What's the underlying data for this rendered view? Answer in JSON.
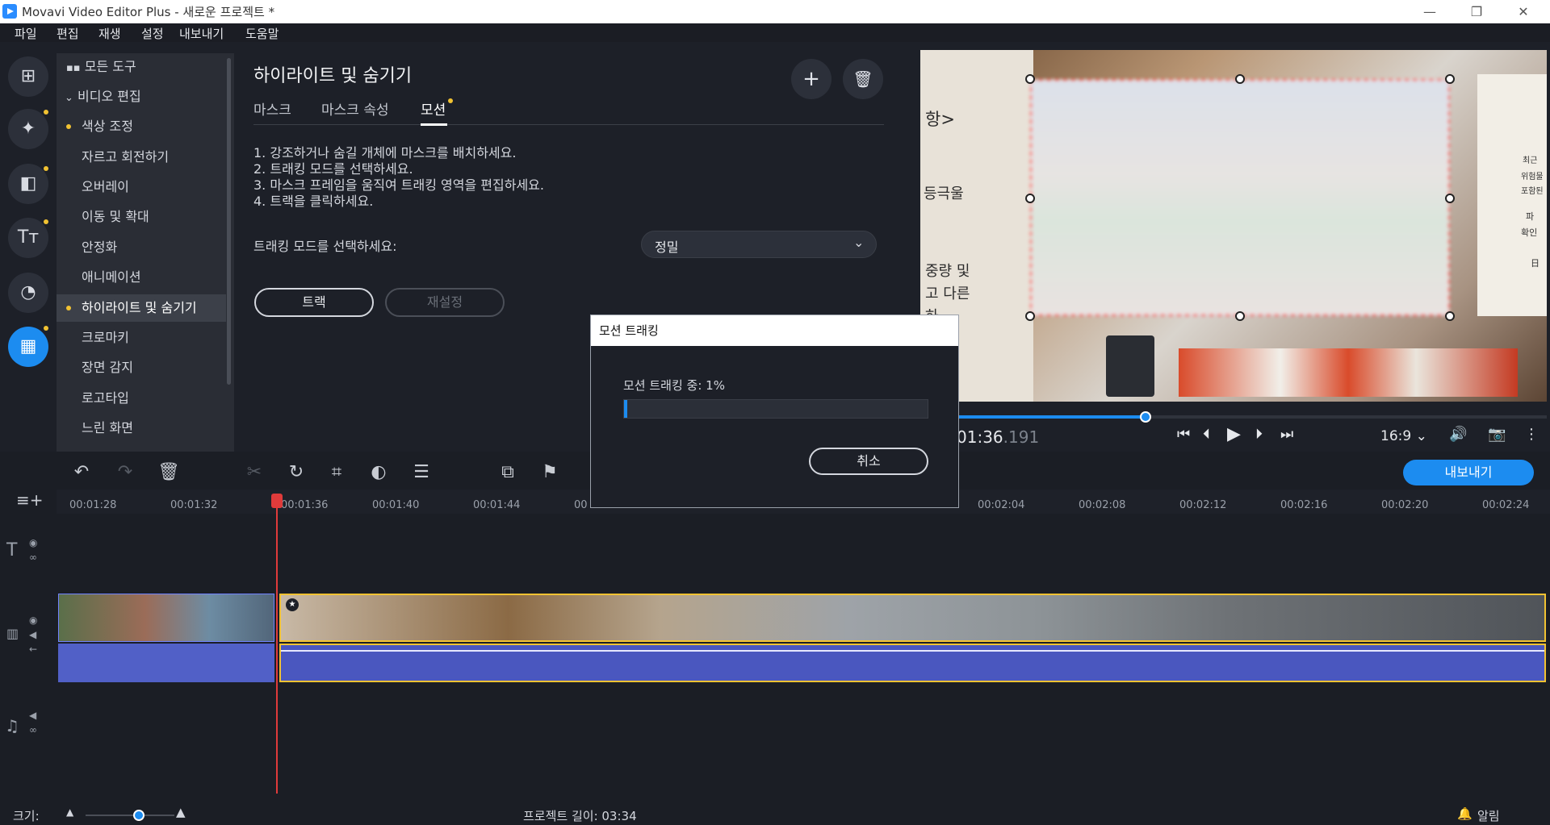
{
  "window": {
    "title": "Movavi Video Editor Plus - 새로운 프로젝트 *",
    "minimize_icon": "minimize-icon",
    "restore_icon": "restore-icon",
    "close_icon": "close-icon"
  },
  "menu": [
    "파일",
    "편집",
    "재생",
    "설정",
    "내보내기",
    "도움말"
  ],
  "tools": {
    "all_tools": "모든 도구",
    "video_edit": "비디오 편집",
    "items": [
      "색상 조정",
      "자르고 회전하기",
      "오버레이",
      "이동 및 확대",
      "안정화",
      "애니메이션",
      "하이라이트 및 숨기기",
      "크로마키",
      "장면 감지",
      "로고타입",
      "느린 화면"
    ]
  },
  "panel": {
    "title": "하이라이트 및 숨기기",
    "tabs": [
      "마스크",
      "마스크 속성",
      "모션"
    ],
    "instructions": [
      "1. 강조하거나 숨길 개체에 마스크를 배치하세요.",
      "2. 트래킹 모드를 선택하세요.",
      "3. 마스크 프레임을 움직여 트래킹 영역을 편집하세요.",
      "4. 트랙을 클릭하세요."
    ],
    "tracking_mode_label": "트래킹 모드를 선택하세요:",
    "tracking_mode_value": "정밀",
    "track_button": "트랙",
    "reset_button": "재설정"
  },
  "preview": {
    "sign_texts": [
      "항>",
      "등극울",
      "중량 및",
      "고 다른",
      "하",
      "최근",
      "위험물",
      "포함된",
      "파",
      "확인",
      "日"
    ],
    "time_main": "01:36",
    "time_ms": ".191",
    "scrub_progress": 0.36,
    "aspect": "16:9"
  },
  "timeline": {
    "ticks": [
      "00:01:28",
      "00:01:32",
      "00:01:36",
      "00:01:40",
      "00:01:44",
      "00",
      "00:02:04",
      "00:02:08",
      "00:02:12",
      "00:02:16",
      "00:02:20",
      "00:02:24"
    ],
    "export_button": "내보내기"
  },
  "status": {
    "size_label": "크기:",
    "zoom_level": 0.6,
    "project_length": "프로젝트 길이: 03:34",
    "notifications": "알림"
  },
  "dialog": {
    "title": "모션 트래킹",
    "progress_text": "모션 트래킹 중: 1%",
    "progress": 0.01,
    "cancel_button": "취소"
  },
  "colors": {
    "accent": "#1c8cf0",
    "highlight": "#f1c232",
    "playhead": "#e03b3b"
  }
}
